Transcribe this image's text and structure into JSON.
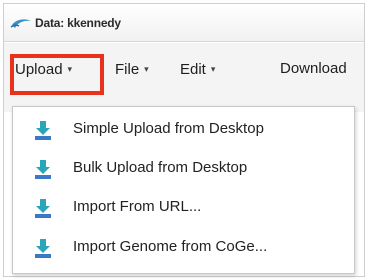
{
  "window": {
    "title": "Data: kkennedy"
  },
  "menubar": {
    "items": [
      {
        "label": "Upload",
        "caret": "▾"
      },
      {
        "label": "File",
        "caret": "▾"
      },
      {
        "label": "Edit",
        "caret": "▾"
      },
      {
        "label": "Download",
        "caret": ""
      }
    ]
  },
  "upload_menu": {
    "items": [
      {
        "label": "Simple Upload from Desktop",
        "icon": "upload-icon"
      },
      {
        "label": "Bulk Upload from Desktop",
        "icon": "upload-icon"
      },
      {
        "label": "Import From URL...",
        "icon": "upload-icon"
      },
      {
        "label": "Import Genome from CoGe...",
        "icon": "upload-icon"
      }
    ]
  },
  "colors": {
    "highlight": "#e8321e",
    "icon_teal": "#2aa6b8",
    "icon_base": "#3a78c8"
  }
}
